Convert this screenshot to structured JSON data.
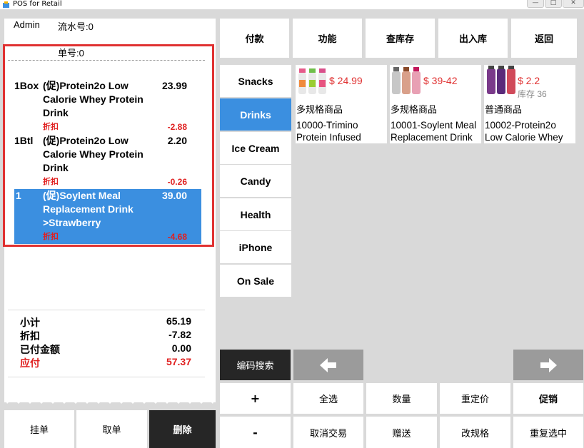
{
  "window": {
    "title": "POS for Retail",
    "min_glyph": "—",
    "max_glyph": "□",
    "close_glyph": "✕"
  },
  "receipt": {
    "user": "Admin",
    "serial_label": "流水号:0",
    "order_label": "单号:0",
    "items": [
      {
        "qty": "1Box",
        "name": "(促)Protein2o Low Calorie Whey Protein Drink",
        "price": "23.99",
        "discount_label": "折扣",
        "discount": "-2.88",
        "selected": false
      },
      {
        "qty": "1Btl",
        "name": "(促)Protein2o Low Calorie Whey Protein Drink",
        "price": "2.20",
        "discount_label": "折扣",
        "discount": "-0.26",
        "selected": false
      },
      {
        "qty": "1",
        "name": "(促)Soylent Meal Replacement Drink >Strawberry",
        "price": "39.00",
        "discount_label": "折扣",
        "discount": "-4.68",
        "selected": true
      }
    ],
    "totals": {
      "subtotal_label": "小计",
      "subtotal": "65.19",
      "discount_label": "折扣",
      "discount": "-7.82",
      "paid_label": "已付金额",
      "paid": "0.00",
      "due_label": "应付",
      "due": "57.37"
    }
  },
  "bottom_left": {
    "hold": "挂单",
    "retrieve": "取单",
    "delete": "删除"
  },
  "top_buttons": {
    "pay": "付款",
    "function": "功能",
    "stock_check": "查库存",
    "stock_io": "出入库",
    "back": "返回"
  },
  "categories": [
    "Snacks",
    "Drinks",
    "Ice Cream",
    "Candy",
    "Health",
    "iPhone",
    "On Sale"
  ],
  "active_category": "Drinks",
  "products": [
    {
      "price": "$ 24.99",
      "stock": "",
      "type": "多规格商品",
      "name": "10000-Trimino Protein Infused"
    },
    {
      "price": "$ 39-42",
      "stock": "",
      "type": "多规格商品",
      "name": "10001-Soylent Meal Replacement Drink"
    },
    {
      "price": "$ 2.2",
      "stock": "库存 36",
      "type": "普通商品",
      "name": "10002-Protein2o Low Calorie Whey"
    }
  ],
  "search": {
    "code_search": "编码搜索"
  },
  "actions": {
    "plus": "+",
    "select_all": "全选",
    "quantity": "数量",
    "reprice": "重定价",
    "promotion": "促销",
    "minus": "-",
    "cancel_txn": "取消交易",
    "gift": "赠送",
    "change_spec": "改规格",
    "reselect": "重复选中"
  },
  "colors": {
    "accent": "#3b8fe0",
    "danger": "#e03131",
    "dark": "#262626",
    "arrow_bg": "#9b9b9b",
    "background": "#d9d9d9"
  },
  "icons": {
    "app": "pos-app-icon",
    "left": "arrow-left-icon",
    "right": "arrow-right-icon"
  }
}
